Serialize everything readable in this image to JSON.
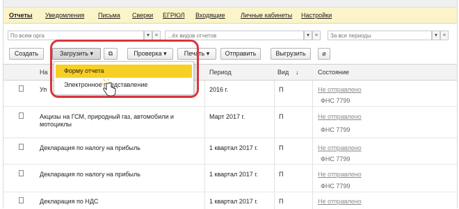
{
  "tabs": [
    {
      "label": "Отчеты",
      "active": true
    },
    {
      "label": "Уведомления"
    },
    {
      "label": "Письма"
    },
    {
      "label": "Сверки"
    },
    {
      "label": "ЕГРЮЛ"
    },
    {
      "label": "Входящие"
    },
    {
      "label": "Личные кабинеты"
    },
    {
      "label": "Настройки"
    }
  ],
  "filters": {
    "org_placeholder": "По всем орга",
    "reports_placeholder": "...ёх видов отчетов",
    "period_placeholder": "За все периоды"
  },
  "toolbar": {
    "create": "Создать",
    "load": "Загрузить",
    "check": "Проверка",
    "print": "Печать",
    "send": "Отправить",
    "unload": "Выгрузить"
  },
  "dropdown": {
    "items": [
      "Форму отчета",
      "Электронное представление"
    ]
  },
  "table": {
    "headers": {
      "name": "На",
      "period": "Период",
      "kind": "Вид",
      "kind_sort": "↓",
      "state": "Состояние"
    },
    "rows": [
      {
        "name": "Уп",
        "period": "2016 г.",
        "kind": "П",
        "state": "Не отправлено",
        "recipient": "ФНС 7799"
      },
      {
        "name": "Акцизы на ГСМ, природный газ, автомобили и мотоциклы",
        "period": "Март 2017 г.",
        "kind": "П",
        "state": "Не отправлено",
        "recipient": "ФНС 7799"
      },
      {
        "name": "Декларация по налогу на прибыль",
        "period": "1 квартал 2017 г.",
        "kind": "П",
        "state": "Не отправлено",
        "recipient": "ФНС 7799"
      },
      {
        "name": "Декларация по налогу на прибыль",
        "period": "1 квартал 2017 г.",
        "kind": "П",
        "state": "Не отправлено",
        "recipient": "ФНС 7799"
      },
      {
        "name": "Декларация по НДС",
        "period": "1 квартал 2017 г.",
        "kind": "П",
        "state": "Не отправлено",
        "recipient": ""
      }
    ]
  },
  "colors": {
    "tabbar": "#fbf4c8",
    "highlight": "#f7cf25",
    "annotation": "#d9343c"
  }
}
